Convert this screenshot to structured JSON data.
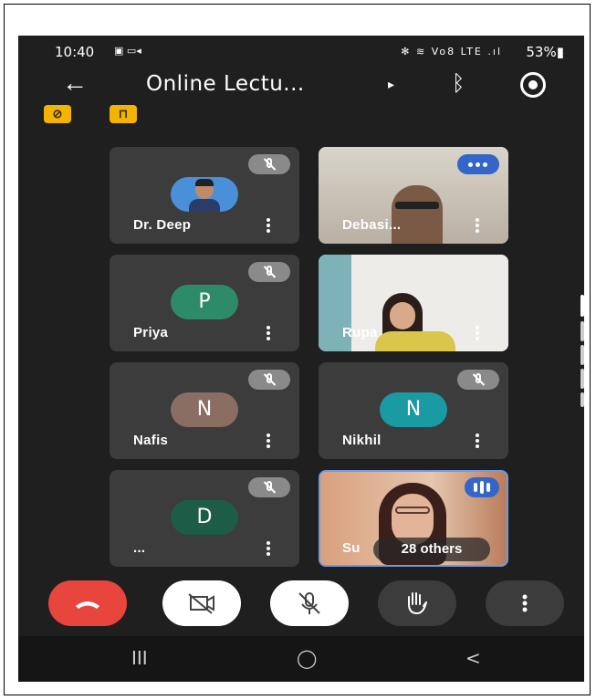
{
  "status_bar": {
    "time": "10:40",
    "battery": "53%",
    "network": "Vo8 LTE"
  },
  "app_bar": {
    "title": "Online Lectu...",
    "caret": "▸",
    "bluetooth_glyph": "∦"
  },
  "chips": [
    "camera-off-chip",
    "lecture-chip"
  ],
  "participants": [
    {
      "name": "Dr. Deep",
      "kind": "photo-avatar",
      "muted": true
    },
    {
      "name": "Debasi...",
      "kind": "video",
      "muted": false
    },
    {
      "name": "Priya",
      "kind": "letter",
      "letter": "P",
      "color": "#2e8b6a",
      "muted": true
    },
    {
      "name": "Rupa",
      "kind": "video",
      "muted": false
    },
    {
      "name": "Nafis",
      "kind": "letter",
      "letter": "N",
      "color": "#8a6e64",
      "muted": true
    },
    {
      "name": "Nikhil",
      "kind": "letter",
      "letter": "N",
      "color": "#1a9aa3",
      "muted": true
    },
    {
      "name": "...",
      "kind": "letter",
      "letter": "D",
      "color": "#1d5c46",
      "muted": true
    },
    {
      "name": "Su",
      "kind": "video",
      "muted": false,
      "overlay": "28 others"
    }
  ],
  "controls": [
    {
      "name": "end-call",
      "color": "#e8453c"
    },
    {
      "name": "camera-off",
      "color": "#ffffff"
    },
    {
      "name": "mic-off",
      "color": "#ffffff"
    },
    {
      "name": "raise-hand",
      "color": "#3c3c3c"
    },
    {
      "name": "more-options",
      "color": "#3c3c3c"
    }
  ],
  "nav": {
    "recents": "III",
    "home": "◯",
    "back": "<"
  }
}
